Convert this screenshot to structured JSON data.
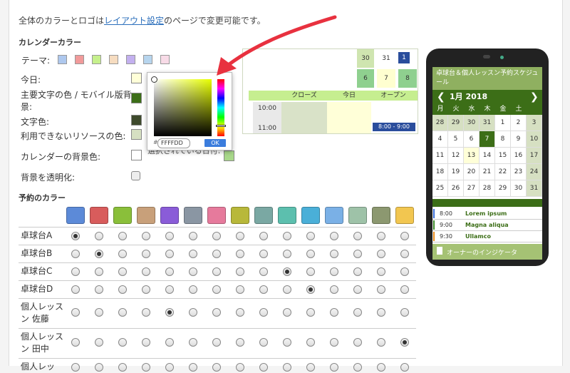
{
  "intro": {
    "before": "全体のカラーとロゴは",
    "link": "レイアウト設定",
    "after": "のページで変更可能です。"
  },
  "calendar_colors": {
    "heading": "カレンダーカラー",
    "theme_label": "テーマ:",
    "theme_swatches": [
      "#aec8ee",
      "#f19a9a",
      "#c6f08c",
      "#f6dcc0",
      "#c3b0ef",
      "#b7d5ee",
      "#f8dbe7"
    ],
    "items": [
      {
        "label": "今日:",
        "color": "#ffffd8"
      },
      {
        "label": "主要文字の色 / モバイル版背景:",
        "color": "#3c6e17"
      },
      {
        "label": "文字色:",
        "color": "#3e4a2c"
      },
      {
        "label": "利用できないリソースの色:",
        "color": "#d6e0c2"
      },
      {
        "label": "カレンダーの背景色:",
        "color": "#ffffff"
      }
    ],
    "transparent_label": "背景を透明化:",
    "obscured_label": "選択されている日付:"
  },
  "picker": {
    "hash": "#",
    "hex": "FFFFDD",
    "ok": "OK"
  },
  "calendar_preview": {
    "top_dates": [
      "30",
      "31",
      "1"
    ],
    "mid_dates": [
      "6",
      "7",
      "8"
    ],
    "columns": [
      "クローズ",
      "今日",
      "オープン"
    ],
    "times": [
      "10:00",
      "11:00"
    ],
    "event": "8:00 - 9:00"
  },
  "phone": {
    "title": "卓球台＆個人レッスン予約スケジュール",
    "month": "1月 2018",
    "weekdays": [
      "月",
      "火",
      "水",
      "木",
      "金",
      "土"
    ],
    "weeks": [
      [
        "28",
        "29",
        "30",
        "31",
        "1",
        "2",
        "3"
      ],
      [
        "4",
        "5",
        "6",
        "7",
        "8",
        "9",
        "10"
      ],
      [
        "11",
        "12",
        "13",
        "14",
        "15",
        "16",
        "17"
      ],
      [
        "18",
        "19",
        "20",
        "21",
        "22",
        "23",
        "24"
      ],
      [
        "25",
        "26",
        "27",
        "28",
        "29",
        "30",
        "31"
      ]
    ],
    "events": [
      {
        "time": "8:00",
        "name": "Lorem ipsum",
        "color": "#3a6ed8"
      },
      {
        "time": "9:00",
        "name": "Magna aliqua",
        "color": "#3c8a2a"
      },
      {
        "time": "9:30",
        "name": "Ullamco",
        "color": "#e88a1a"
      }
    ],
    "owner_indicator": "オーナーのインジケータ"
  },
  "booking_colors": {
    "heading": "予約のカラー",
    "palette": [
      "#5c8ad8",
      "#d85c5c",
      "#8abf3a",
      "#c8a07a",
      "#8a5cd8",
      "#8a96a3",
      "#e67a9c",
      "#b8b83a",
      "#7aa8a3",
      "#5cbfae",
      "#4aafd8",
      "#7ab0e6",
      "#9ec2a8",
      "#8c9870",
      "#f2c650"
    ],
    "rows": [
      {
        "label": "卓球台A",
        "selected": 0
      },
      {
        "label": "卓球台B",
        "selected": 1
      },
      {
        "label": "卓球台C",
        "selected": 9
      },
      {
        "label": "卓球台D",
        "selected": 10
      },
      {
        "label": "個人レッスン 佐藤",
        "selected": 4
      },
      {
        "label": "個人レッスン 田中",
        "selected": 14
      },
      {
        "label": "個人レッ",
        "selected": -1
      }
    ]
  }
}
